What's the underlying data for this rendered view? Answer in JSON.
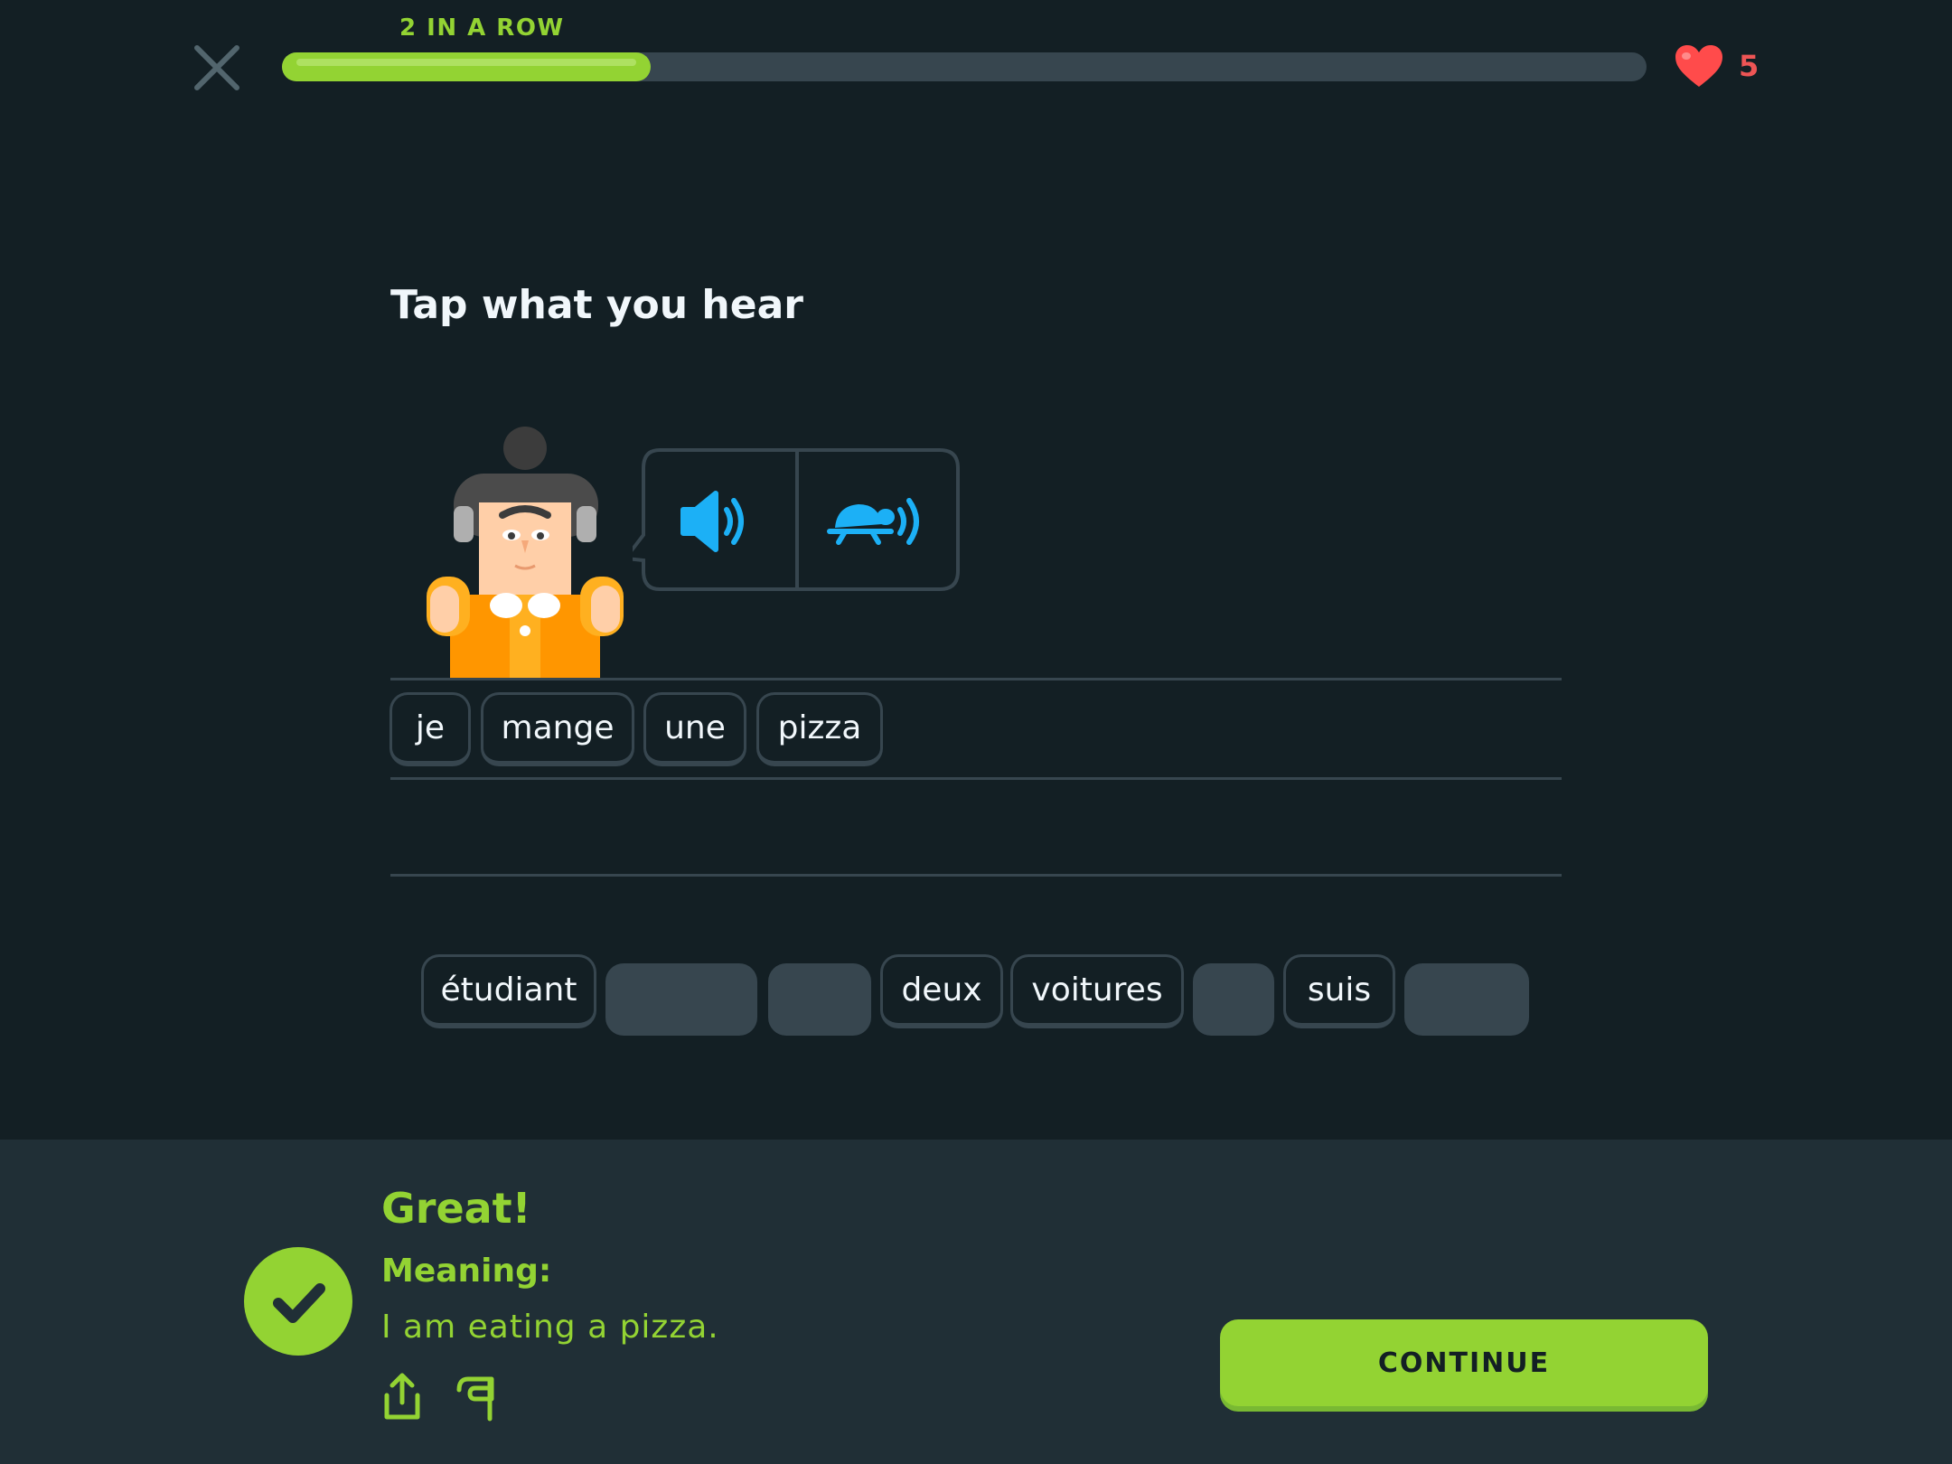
{
  "header": {
    "streak_label": "2 IN A ROW",
    "progress_fraction": 0.27,
    "hearts_count": "5",
    "close_icon": "close-icon",
    "heart_icon": "heart-icon"
  },
  "exercise": {
    "instruction": "Tap what you hear",
    "audio_icons": [
      "speaker-icon",
      "turtle-slow-speaker-icon"
    ]
  },
  "answer": {
    "words": [
      "je",
      "mange",
      "une",
      "pizza"
    ]
  },
  "word_bank": {
    "items": [
      {
        "text": "étudiant",
        "used": false
      },
      {
        "text": "",
        "used": true
      },
      {
        "text": "",
        "used": true
      },
      {
        "text": "deux",
        "used": false
      },
      {
        "text": "voitures",
        "used": false
      },
      {
        "text": "",
        "used": true
      },
      {
        "text": "suis",
        "used": false
      },
      {
        "text": "",
        "used": true
      }
    ]
  },
  "feedback": {
    "title": "Great!",
    "meaning_label": "Meaning:",
    "meaning_text": "I am eating a pizza.",
    "continue_label": "CONTINUE",
    "icons": [
      "check-icon",
      "share-icon",
      "flag-icon"
    ]
  },
  "colors": {
    "background": "#131f24",
    "footer": "#202f36",
    "accent_green": "#93d333",
    "audio_blue": "#1cb0f6",
    "heart_red": "#ff4b4b",
    "border": "#37464f"
  }
}
